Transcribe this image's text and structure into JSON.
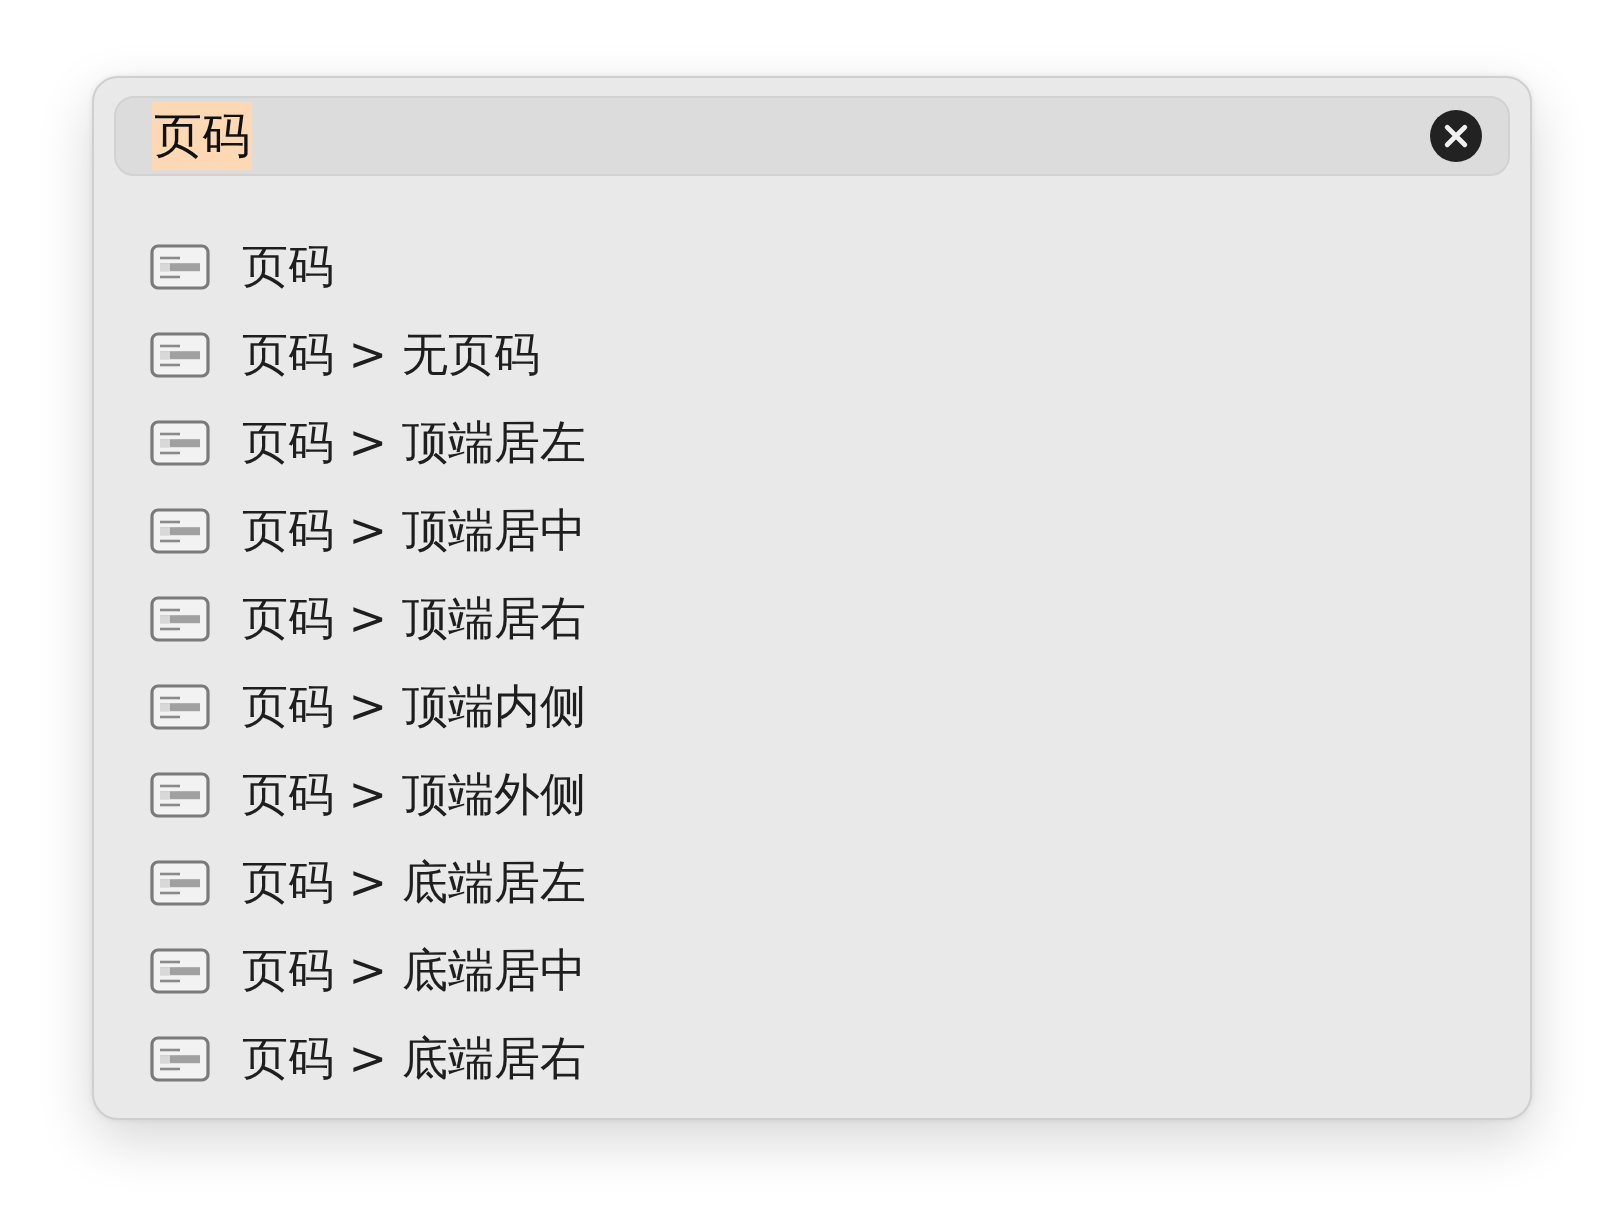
{
  "search": {
    "value": "页码",
    "highlighted": true
  },
  "results": [
    {
      "label": "页码"
    },
    {
      "label": "页码 > 无页码"
    },
    {
      "label": "页码 > 顶端居左"
    },
    {
      "label": "页码 > 顶端居中"
    },
    {
      "label": "页码 > 顶端居右"
    },
    {
      "label": "页码 > 顶端内侧"
    },
    {
      "label": "页码 > 顶端外侧"
    },
    {
      "label": "页码 > 底端居左"
    },
    {
      "label": "页码 > 底端居中"
    },
    {
      "label": "页码 > 底端居右"
    }
  ]
}
